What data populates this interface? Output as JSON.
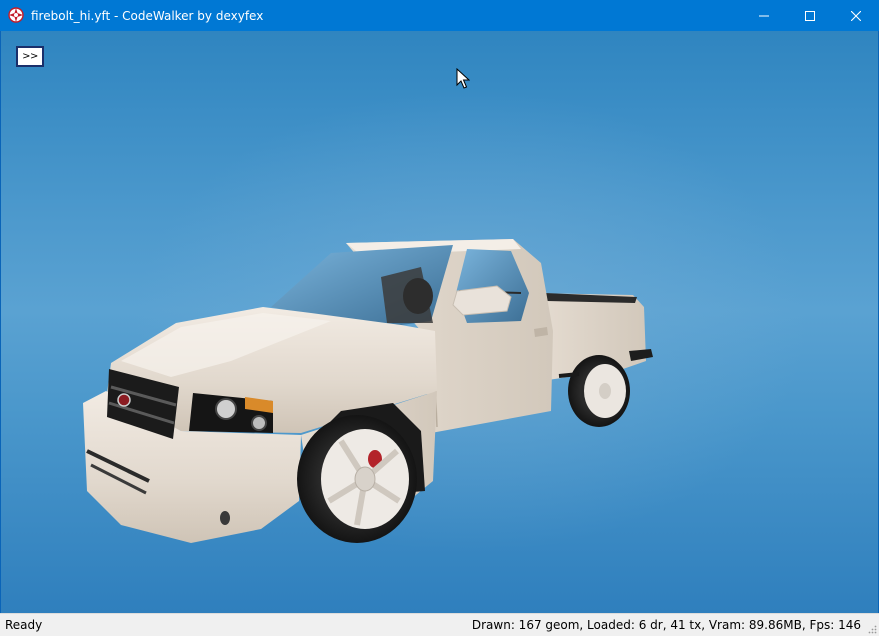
{
  "window": {
    "title": "firebolt_hi.yft - CodeWalker by dexyfex",
    "app_icon": "codewalker-app-icon",
    "controls": [
      "minimize-icon",
      "maximize-icon",
      "close-icon"
    ]
  },
  "viewport": {
    "toggle_label": ">>",
    "model_name": "firebolt_hi.yft",
    "colors": {
      "sky_top": "#2f85c0",
      "sky_mid": "#5aa2d2",
      "body_paint": "#ece4dc"
    }
  },
  "statusbar": {
    "left_text": "Ready",
    "right_text": "Drawn: 167 geom, Loaded: 6 dr, 41 tx, Vram: 89.86MB, Fps: 146"
  }
}
